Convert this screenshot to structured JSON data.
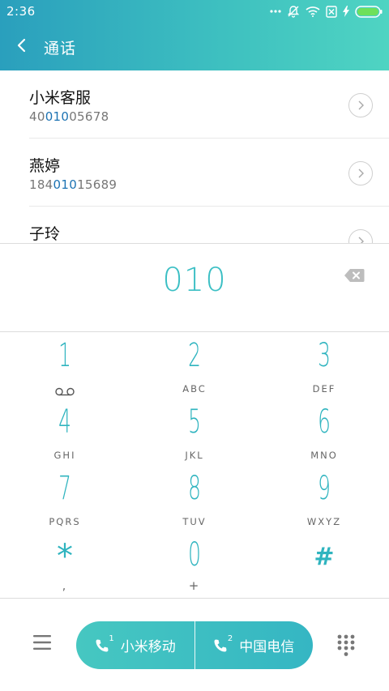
{
  "status_bar": {
    "time": "2:36",
    "icons": [
      "more-dots-icon",
      "mute-bell-icon",
      "wifi-icon",
      "no-sim-icon",
      "charging-icon",
      "battery-icon"
    ]
  },
  "header": {
    "title": "通话",
    "back_icon": "chevron-left-icon"
  },
  "contacts": [
    {
      "name": "小米客服",
      "number_pre": "40",
      "number_match": "010",
      "number_post": "05678"
    },
    {
      "name": "燕婷",
      "number_pre": "184",
      "number_match": "010",
      "number_post": "15689"
    },
    {
      "name": "子玲",
      "number_pre": "",
      "number_match": "",
      "number_post": ""
    }
  ],
  "dialer": {
    "dialed_number": "010",
    "delete_icon": "backspace-icon"
  },
  "keypad": {
    "keys": [
      {
        "digit": "1",
        "letters": ""
      },
      {
        "digit": "2",
        "letters": "ABC"
      },
      {
        "digit": "3",
        "letters": "DEF"
      },
      {
        "digit": "4",
        "letters": "GHI"
      },
      {
        "digit": "5",
        "letters": "JKL"
      },
      {
        "digit": "6",
        "letters": "MNO"
      },
      {
        "digit": "7",
        "letters": "PQRS"
      },
      {
        "digit": "8",
        "letters": "TUV"
      },
      {
        "digit": "9",
        "letters": "WXYZ"
      },
      {
        "digit": "*",
        "letters": ","
      },
      {
        "digit": "0",
        "letters": "+"
      },
      {
        "digit": "#",
        "letters": ""
      }
    ]
  },
  "bottom_bar": {
    "sim1_label": "小米移动",
    "sim1_index": "1",
    "sim2_label": "中国电信",
    "sim2_index": "2",
    "menu_icon": "menu-icon",
    "keypad_toggle_icon": "dialpad-grid-icon"
  },
  "colors": {
    "accent": "#3bbfc4",
    "header_start": "#2a9fbd",
    "header_end": "#4fd4c2",
    "match_highlight": "#1d73b3"
  }
}
